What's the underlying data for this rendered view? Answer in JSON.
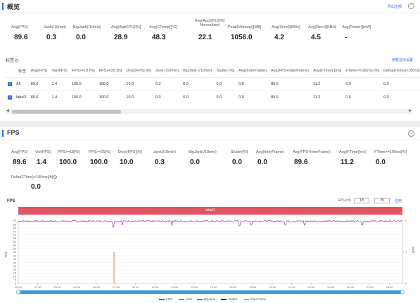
{
  "overview": {
    "title": "概览",
    "export_label": "导出全部",
    "stats": [
      {
        "label": "Avg(FPS)",
        "value": "89.6"
      },
      {
        "label": "Jank(/10min)",
        "value": "0.3"
      },
      {
        "label": "BigJank(/10min)",
        "value": "0.0"
      },
      {
        "label": "Avg(AppCPU)[%]",
        "value": "28.9"
      },
      {
        "label": "Avg(CTemp)[°C]",
        "value": "48.3"
      },
      {
        "label": "Avg(AppCPU)[%] Normalized",
        "value": "22.1"
      },
      {
        "label": "Peak(Memory)[MB]",
        "value": "1056.0"
      },
      {
        "label": "Avg(Send)[KB/s]",
        "value": "4.2"
      },
      {
        "label": "Avg(Recv)[KB/s]",
        "value": "4.5"
      },
      {
        "label": "Avg(Power)[mW]",
        "value": "-"
      }
    ]
  },
  "labels": {
    "title": "标签",
    "settings_link": "参数显示设置",
    "columns": [
      "标签",
      "Avg(FPS)",
      "Var(FPS)",
      "FPS>=18 [%]",
      "FPS>=25 [%]",
      "Drop(FPS) [/h]",
      "Jank (/10min)",
      "BigJank (/10min)",
      "Stutter [%]",
      "Avg(InterFrame)",
      "Avg(FPS+InterFrame)",
      "Avg(FTime) [ms]",
      "FTime>=100ms [%]",
      "Delta(FTime)>100ms [/h]",
      "Av"
    ],
    "rows": [
      {
        "name": "All",
        "cells": [
          "89.6",
          "1.4",
          "100.0",
          "100.0",
          "10.0",
          "0.3",
          "0.0",
          "0.0",
          "0.0",
          "89.6",
          "11.2",
          "0.0",
          "0.0",
          ""
        ]
      },
      {
        "name": "label1",
        "cells": [
          "89.6",
          "1.4",
          "100.0",
          "100.0",
          "10.0",
          "0.3",
          "0.0",
          "0.0",
          "0.0",
          "89.6",
          "11.2",
          "0.0",
          "0.0",
          ""
        ]
      }
    ]
  },
  "fps": {
    "title": "FPS",
    "stats": [
      {
        "label": "Avg(FPS)",
        "value": "89.6"
      },
      {
        "label": "Var(FPS)",
        "value": "1.4"
      },
      {
        "label": "FPS>=18[%]",
        "value": "100.0"
      },
      {
        "label": "FPS>=25[%]",
        "value": "100.0"
      },
      {
        "label": "Drop(FPS)[/h]",
        "value": "10.0"
      },
      {
        "label": "Jank(/10min)",
        "value": "0.3"
      },
      {
        "label": "BigJank(/10min)",
        "value": "0.0"
      },
      {
        "label": "Stutter[%]",
        "value": "0.0"
      },
      {
        "label": "Avg(InterFrame)",
        "value": "0.0"
      },
      {
        "label": "Avg(FPS+InterFrame)",
        "value": "89.6"
      },
      {
        "label": "Avg(FTime)[ms]",
        "value": "11.2"
      },
      {
        "label": "FTime>=100ms[%]",
        "value": "0.0"
      }
    ],
    "delta_label": "Delta(FTime)>100ms[/h]",
    "delta_value": "0.0",
    "chart_title": "FPS",
    "threshold_label": "FPS(>=)",
    "threshold_a": "18",
    "threshold_b": "25",
    "apply_label": "应用",
    "band_label": "label1",
    "y_label": "FPS",
    "y2_label": "Jank"
  },
  "chart_data": {
    "type": "line",
    "title": "FPS",
    "xlabel": "",
    "ylabel": "FPS",
    "y2label": "Jank",
    "ylim": [
      0,
      91
    ],
    "y2lim": [
      0,
      2
    ],
    "yticks": [
      0,
      5,
      10,
      15,
      20,
      25,
      30,
      35,
      40,
      45,
      50,
      55,
      60,
      65,
      70,
      75,
      80,
      85,
      91
    ],
    "y2ticks": [
      0,
      1,
      2
    ],
    "x": [
      "00:00",
      "01:30",
      "03:00",
      "04:30",
      "06:00",
      "07:30",
      "09:00",
      "10:30",
      "12:00",
      "13:30",
      "15:00",
      "16:30",
      "18:00",
      "19:30",
      "21:00",
      "22:30",
      "24:00",
      "25:30",
      "27:00",
      "28:30"
    ],
    "x_minutes_end": 29.5,
    "series": [
      {
        "name": "FPS",
        "color": "#a23aa8",
        "baseline": 89.6,
        "dips": [
          [
            7.3,
            81
          ],
          [
            8.0,
            84
          ],
          [
            11.8,
            83
          ],
          [
            17.0,
            83
          ],
          [
            17.9,
            84
          ],
          [
            20.5,
            84
          ],
          [
            22.0,
            84
          ],
          [
            26.4,
            84
          ]
        ]
      },
      {
        "name": "Jank",
        "color": "#e07a2c",
        "spikes": [
          [
            7.35,
            1
          ]
        ]
      },
      {
        "name": "BigJank",
        "color": "#5a6fd6",
        "spikes": []
      },
      {
        "name": "Stutter",
        "color": "#333333",
        "spikes": []
      },
      {
        "name": "InterFrame",
        "color": "#e0b030",
        "spikes": []
      }
    ],
    "colors": {
      "fps": "#a23aa8",
      "jank": "#b8872a",
      "band": "#e05561",
      "axis": "#bbbbbb",
      "scroll": "#3a9bd8"
    },
    "legend_position": "bottom"
  }
}
